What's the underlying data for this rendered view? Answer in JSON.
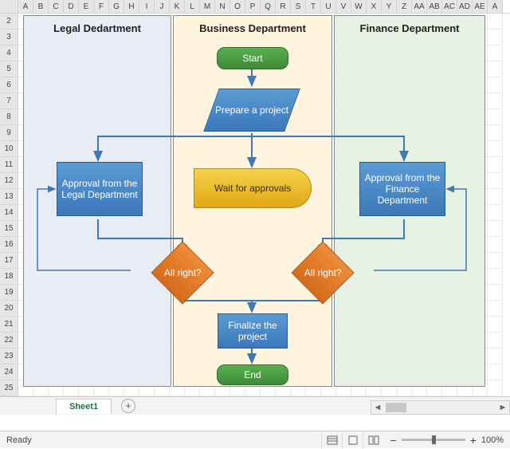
{
  "columns": [
    "A",
    "B",
    "C",
    "D",
    "E",
    "F",
    "G",
    "H",
    "I",
    "J",
    "K",
    "L",
    "M",
    "N",
    "O",
    "P",
    "Q",
    "R",
    "S",
    "T",
    "U",
    "V",
    "W",
    "X",
    "Y",
    "Z",
    "AA",
    "AB",
    "AC",
    "AD",
    "AE",
    "A"
  ],
  "rows": [
    "2",
    "3",
    "4",
    "5",
    "6",
    "7",
    "8",
    "9",
    "10",
    "11",
    "12",
    "13",
    "14",
    "15",
    "16",
    "17",
    "18",
    "19",
    "20",
    "21",
    "22",
    "23",
    "24",
    "25"
  ],
  "lanes": {
    "lane1": "Legal Dedartment",
    "lane2": "Business Department",
    "lane3": "Finance Department"
  },
  "shapes": {
    "start": "Start",
    "prepare": "Prepare a project",
    "wait": "Wait for approvals",
    "approvalLegal": "Approval from the Legal Department",
    "approvalFinance": "Approval from the Finance Department",
    "allright1": "All right?",
    "allright2": "All right?",
    "finalize": "Finalize the project",
    "end": "End"
  },
  "tabs": {
    "sheet1": "Sheet1"
  },
  "status": {
    "ready": "Ready",
    "zoom": "100%"
  }
}
